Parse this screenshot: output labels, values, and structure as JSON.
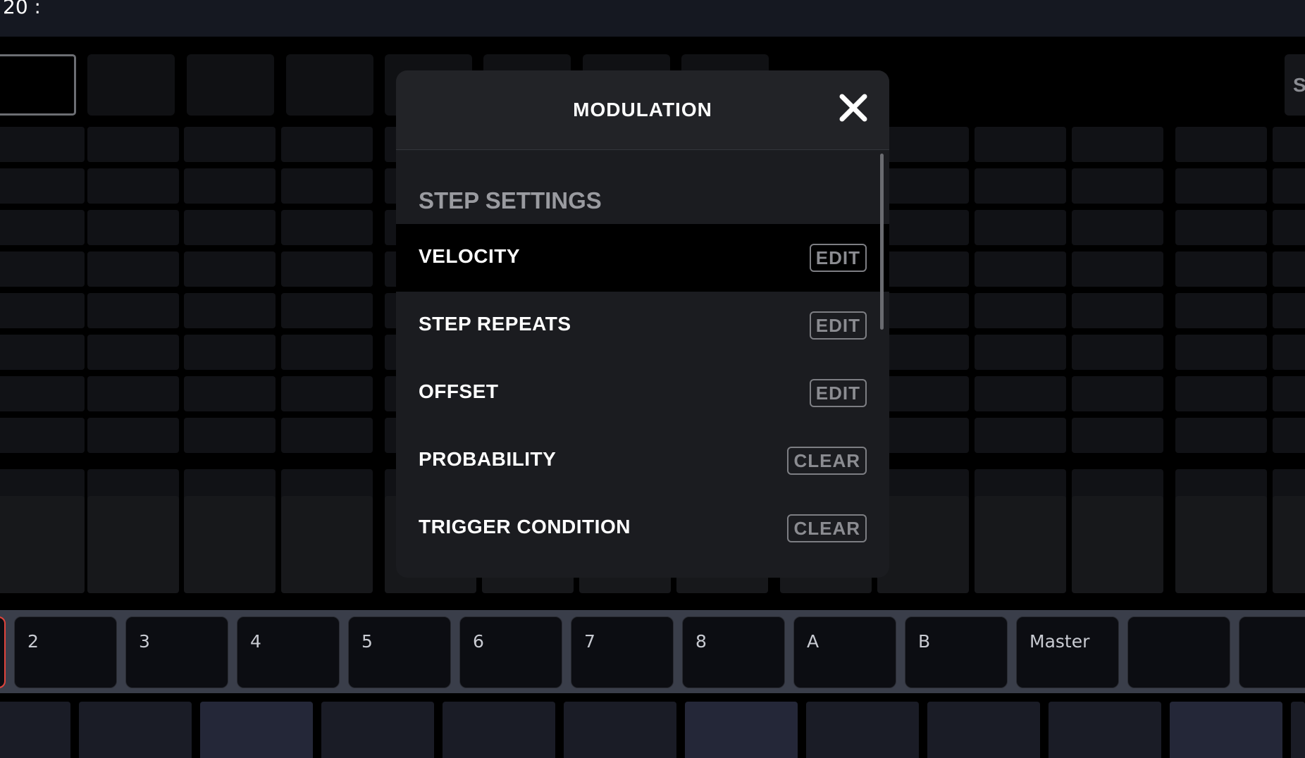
{
  "topbar": {
    "tempo_text": "20 :"
  },
  "pattern_slots": {
    "right_label": "S"
  },
  "tracks": [
    {
      "label": ""
    },
    {
      "label": "2"
    },
    {
      "label": "3"
    },
    {
      "label": "4"
    },
    {
      "label": "5"
    },
    {
      "label": "6"
    },
    {
      "label": "7"
    },
    {
      "label": "8"
    },
    {
      "label": "A"
    },
    {
      "label": "B"
    },
    {
      "label": "Master"
    },
    {
      "label": ""
    },
    {
      "label": ""
    }
  ],
  "modal": {
    "title": "MODULATION",
    "close_icon": "close-icon",
    "section_label": "STEP SETTINGS",
    "rows": [
      {
        "label": "VELOCITY",
        "action": "EDIT",
        "active": true
      },
      {
        "label": "STEP REPEATS",
        "action": "EDIT",
        "active": false
      },
      {
        "label": "OFFSET",
        "action": "EDIT",
        "active": false
      },
      {
        "label": "PROBABILITY",
        "action": "CLEAR",
        "active": false
      },
      {
        "label": "TRIGGER CONDITION",
        "action": "CLEAR",
        "active": false
      }
    ]
  },
  "colors": {
    "selected_track_border": "#e0443c",
    "modal_bg": "#1b1c20",
    "active_row_bg": "#000000",
    "track_bar_bg": "#3a3e4a"
  }
}
